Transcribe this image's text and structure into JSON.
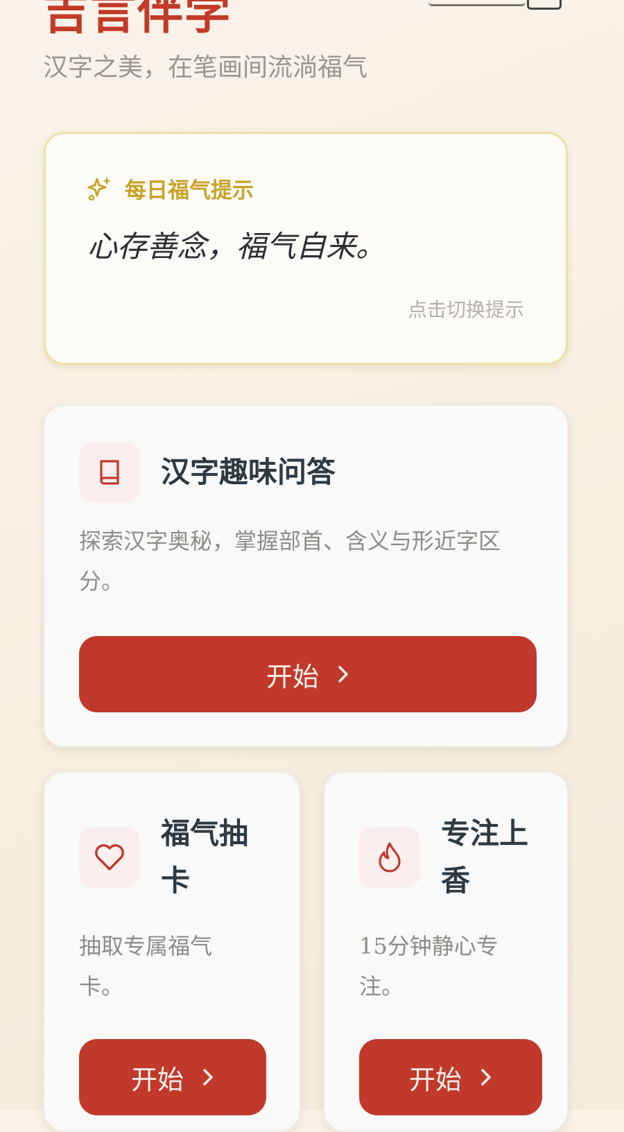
{
  "header": {
    "app_title": "吉言伴学",
    "subtitle": "汉字之美，在笔画间流淌福气"
  },
  "daily_tip": {
    "label": "每日福气提示",
    "quote": "心存善念，福气自来。",
    "switch_hint": "点击切换提示",
    "icon": "sparkles-icon"
  },
  "cards": {
    "quiz": {
      "title": "汉字趣味问答",
      "description": "探索汉字奥秘，掌握部首、含义与形近字区分。",
      "button_label": "开始",
      "icon": "book-icon"
    },
    "card_draw": {
      "title": "福气抽卡",
      "description": "抽取专属福气卡。",
      "button_label": "开始",
      "icon": "heart-icon"
    },
    "incense": {
      "title": "专注上香",
      "description": "15分钟静心专注。",
      "button_label": "开始",
      "icon": "flame-icon"
    }
  },
  "colors": {
    "brand_red": "#c23a28",
    "button_red": "#c0392b",
    "gold": "#c9a227",
    "title_dark": "#2d3a44",
    "muted_text": "#8f8c88",
    "background": "#f6eedf"
  }
}
